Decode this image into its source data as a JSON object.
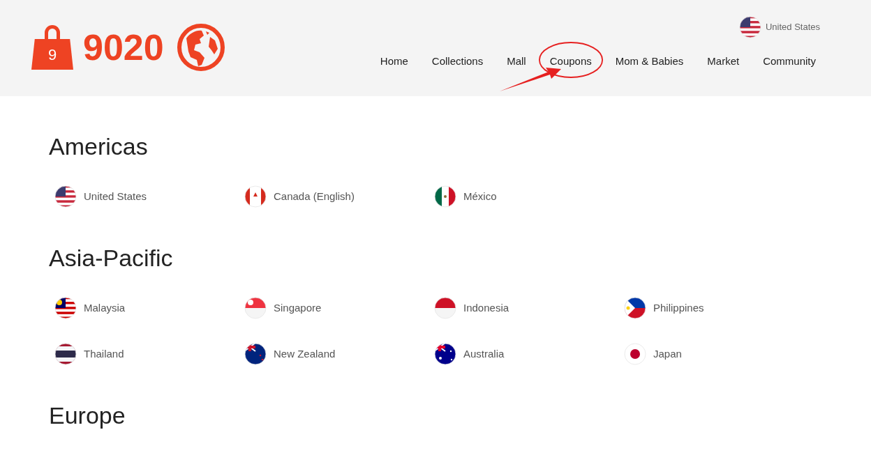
{
  "header": {
    "logo": {
      "badge": "9",
      "name": "9020"
    },
    "region": "United States",
    "nav": [
      {
        "label": "Home",
        "highlighted": false
      },
      {
        "label": "Collections",
        "highlighted": false
      },
      {
        "label": "Mall",
        "highlighted": false
      },
      {
        "label": "Coupons",
        "highlighted": true
      },
      {
        "label": "Mom & Babies",
        "highlighted": false
      },
      {
        "label": "Market",
        "highlighted": false
      },
      {
        "label": "Community",
        "highlighted": false
      }
    ]
  },
  "regions": [
    {
      "title": "Americas",
      "countries": [
        "United States",
        "Canada (English)",
        "México"
      ]
    },
    {
      "title": "Asia-Pacific",
      "countries": [
        "Malaysia",
        "Singapore",
        "Indonesia",
        "Philippines",
        "Thailand",
        "New Zealand",
        "Australia",
        "Japan"
      ]
    },
    {
      "title": "Europe"
    }
  ]
}
